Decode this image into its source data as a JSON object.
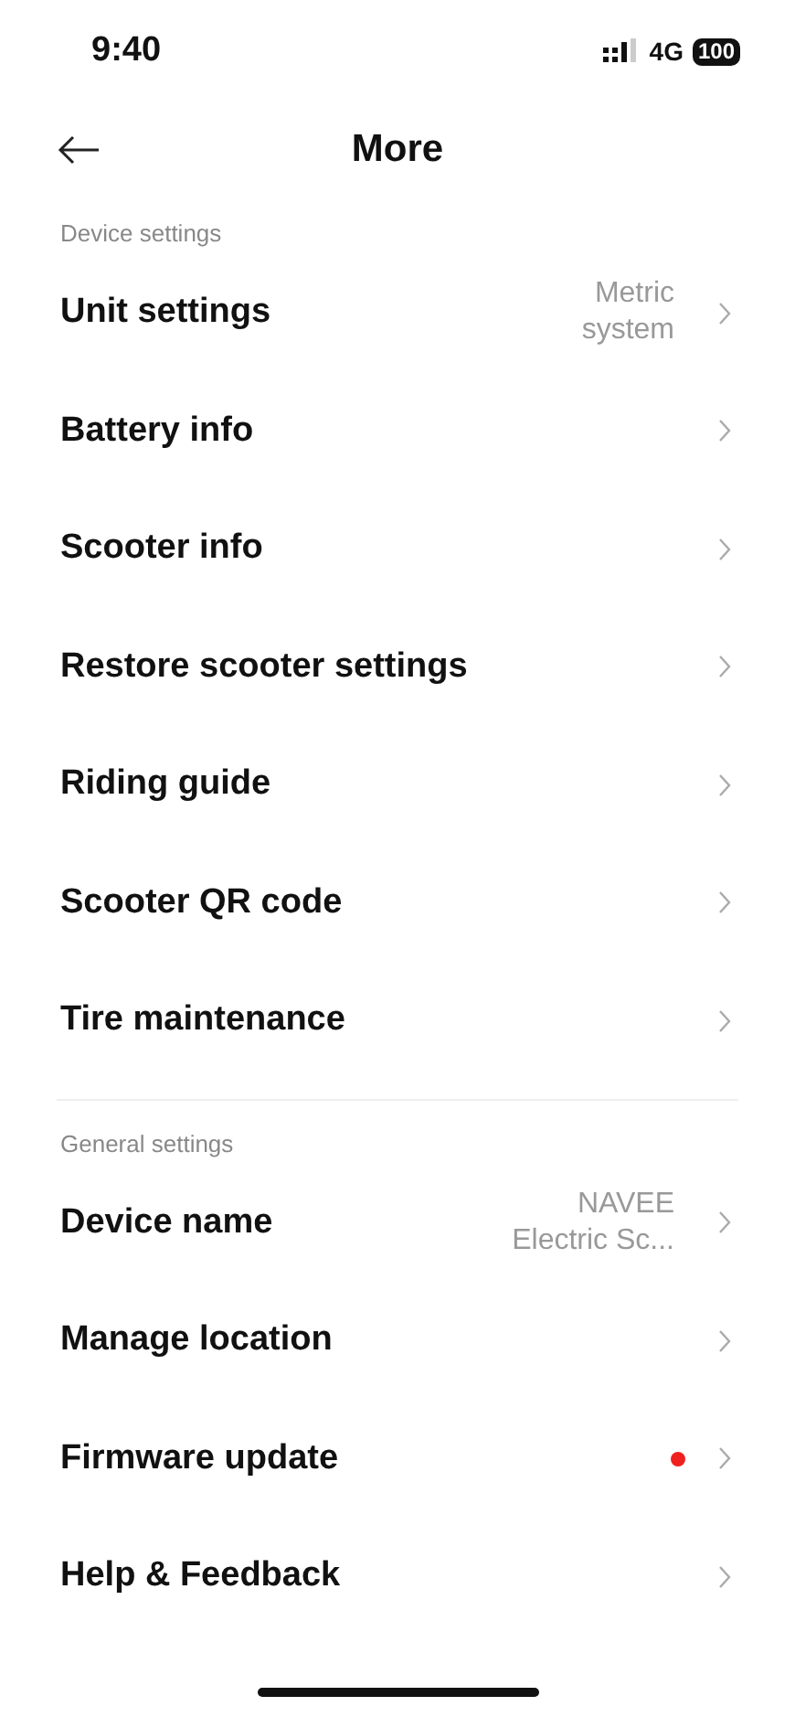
{
  "status_bar": {
    "time": "9:40",
    "network": "4G",
    "battery": "100"
  },
  "header": {
    "title": "More"
  },
  "sections": [
    {
      "title": "Device settings",
      "items": [
        {
          "label": "Unit settings",
          "value": "Metric\nsystem",
          "dot": false
        },
        {
          "label": "Battery info",
          "dot": false
        },
        {
          "label": "Scooter info",
          "dot": false
        },
        {
          "label": "Restore scooter settings",
          "dot": false
        },
        {
          "label": "Riding guide",
          "dot": false
        },
        {
          "label": "Scooter QR code",
          "dot": false
        },
        {
          "label": "Tire maintenance",
          "dot": false
        }
      ]
    },
    {
      "title": "General settings",
      "items": [
        {
          "label": "Device name",
          "value": "NAVEE\nElectric Sc...",
          "dot": false
        },
        {
          "label": "Manage location",
          "dot": false
        },
        {
          "label": "Firmware update",
          "dot": true
        },
        {
          "label": "Help & Feedback",
          "dot": false
        }
      ]
    }
  ]
}
